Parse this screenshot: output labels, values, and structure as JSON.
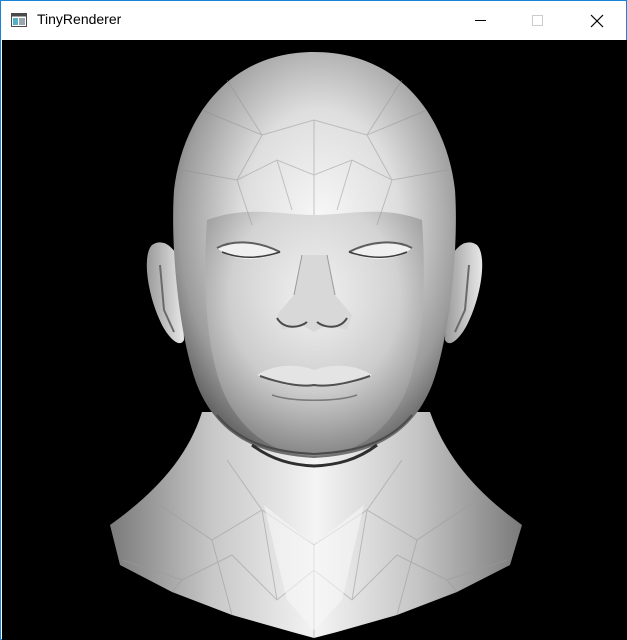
{
  "window": {
    "title": "TinyRenderer",
    "icon": "window-app-icon",
    "controls": {
      "minimize": "minimize-icon",
      "maximize": "maximize-icon",
      "close": "close-icon"
    }
  },
  "viewport": {
    "content": "flat-shaded-3d-head-render",
    "background_color": "#000000"
  },
  "colors": {
    "titlebar": "#ffffff",
    "border": "#1883d7",
    "title_text": "#000000",
    "disabled_control": "#cccccc"
  }
}
